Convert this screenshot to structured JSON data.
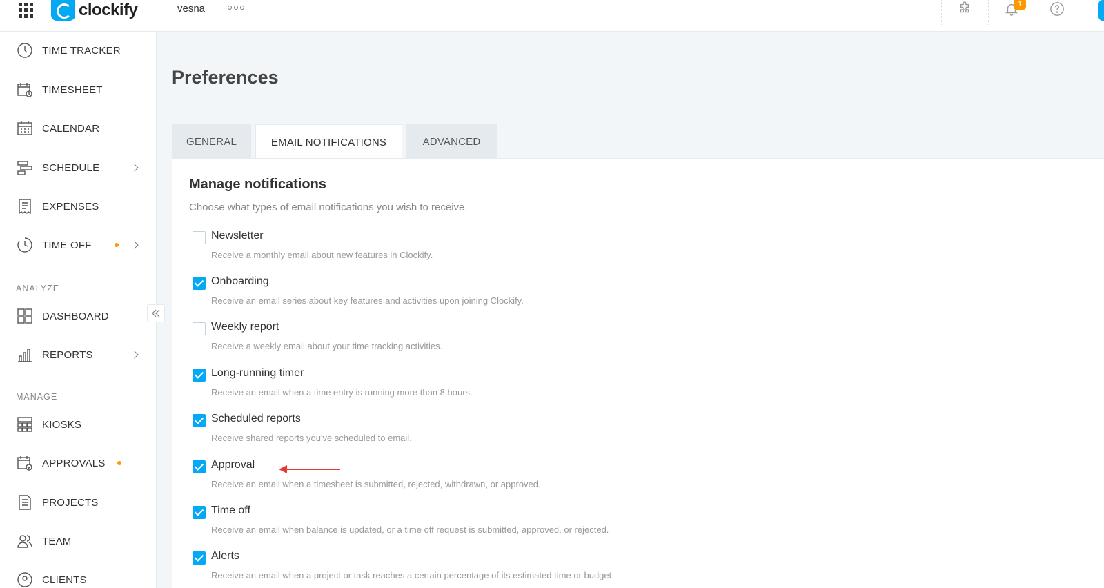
{
  "header": {
    "logo_text": "clockify",
    "workspace": "vesna",
    "notification_count": "1",
    "icons": [
      "apps-grid-icon",
      "puzzle-icon",
      "bell-icon",
      "help-icon"
    ]
  },
  "sidebar": {
    "items": [
      {
        "label": "TIME TRACKER",
        "icon": "clock-icon"
      },
      {
        "label": "TIMESHEET",
        "icon": "timesheet-icon"
      },
      {
        "label": "CALENDAR",
        "icon": "calendar-icon"
      },
      {
        "label": "SCHEDULE",
        "icon": "schedule-icon"
      },
      {
        "label": "EXPENSES",
        "icon": "receipt-icon"
      },
      {
        "label": "TIME OFF",
        "icon": "time-off-icon"
      }
    ],
    "analyze_label": "ANALYZE",
    "analyze_items": [
      {
        "label": "DASHBOARD",
        "icon": "dashboard-icon"
      },
      {
        "label": "REPORTS",
        "icon": "bar-chart-icon"
      }
    ],
    "manage_label": "MANAGE",
    "manage_items": [
      {
        "label": "KIOSKS",
        "icon": "kiosk-icon"
      },
      {
        "label": "APPROVALS",
        "icon": "approvals-icon"
      },
      {
        "label": "PROJECTS",
        "icon": "document-icon"
      },
      {
        "label": "TEAM",
        "icon": "team-icon"
      },
      {
        "label": "CLIENTS",
        "icon": "clients-icon"
      }
    ]
  },
  "main": {
    "title": "Preferences",
    "tabs": [
      {
        "label": "GENERAL",
        "active": false
      },
      {
        "label": "EMAIL NOTIFICATIONS",
        "active": true
      },
      {
        "label": "ADVANCED",
        "active": false
      }
    ],
    "manage_title": "Manage notifications",
    "manage_subtitle": "Choose what types of email notifications you wish to receive.",
    "notifications": [
      {
        "title": "Newsletter",
        "desc": "Receive a monthly email about new features in Clockify.",
        "checked": false
      },
      {
        "title": "Onboarding",
        "desc": "Receive an email series about key features and activities upon joining Clockify.",
        "checked": true
      },
      {
        "title": "Weekly report",
        "desc": "Receive a weekly email about your time tracking activities.",
        "checked": false
      },
      {
        "title": "Long-running timer",
        "desc": "Receive an email when a time entry is running more than 8 hours.",
        "checked": true
      },
      {
        "title": "Scheduled reports",
        "desc": "Receive shared reports you've scheduled to email.",
        "checked": true
      },
      {
        "title": "Approval",
        "desc": "Receive an email when a timesheet is submitted, rejected, withdrawn, or approved.",
        "checked": true
      },
      {
        "title": "Time off",
        "desc": "Receive an email when balance is updated, or a time off request is submitted, approved, or rejected.",
        "checked": true
      },
      {
        "title": "Alerts",
        "desc": "Receive an email when a project or task reaches a certain percentage of its estimated time or budget.",
        "checked": true
      }
    ]
  },
  "colors": {
    "accent": "#03a9f4",
    "dot": "#ff9800",
    "annotation_arrow": "#e53935"
  }
}
